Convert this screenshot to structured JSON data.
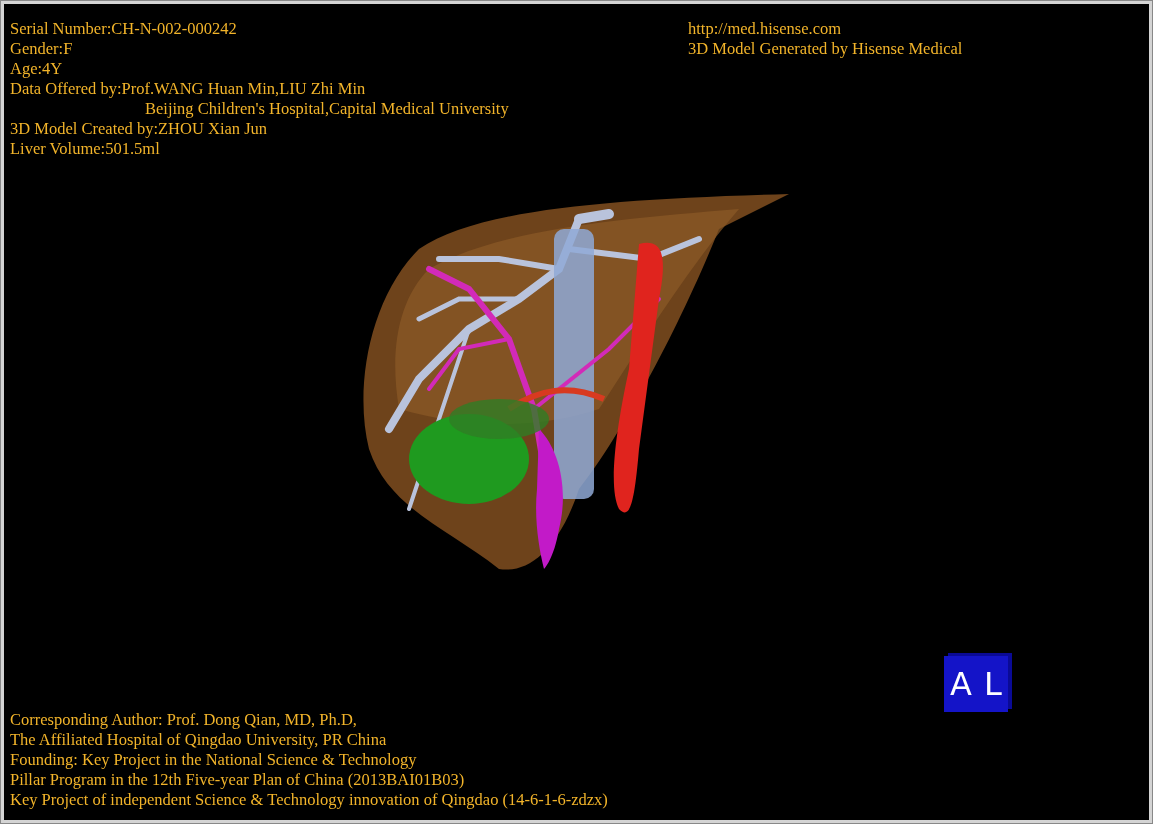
{
  "info_left": [
    {
      "kind": "line",
      "text": "Serial Number:CH-N-002-000242"
    },
    {
      "kind": "line",
      "text": "Gender:F"
    },
    {
      "kind": "line",
      "text": "Age:4Y"
    },
    {
      "kind": "line",
      "text": "Data Offered by:Prof.WANG Huan Min,LIU Zhi Min"
    },
    {
      "kind": "indent",
      "text": "Beijing Children's Hospital,Capital Medical University"
    },
    {
      "kind": "line",
      "text": "3D Model Created by:ZHOU Xian Jun"
    },
    {
      "kind": "line",
      "text": "Liver Volume:501.5ml"
    }
  ],
  "info_right": [
    "http://med.hisense.com",
    "3D Model Generated by Hisense Medical"
  ],
  "credits": [
    "Corresponding Author: Prof. Dong Qian, MD, Ph.D,",
    "The Affiliated Hospital of Qingdao University, PR China",
    "Founding: Key Project in the National Science & Technology",
    "Pillar Program in the 12th Five-year Plan of China (2013BAI01B03)",
    "Key Project of independent Science & Technology innovation of Qingdao (14-6-1-6-zdzx)"
  ],
  "orientation_cube": {
    "labels": [
      "A",
      "L"
    ]
  }
}
